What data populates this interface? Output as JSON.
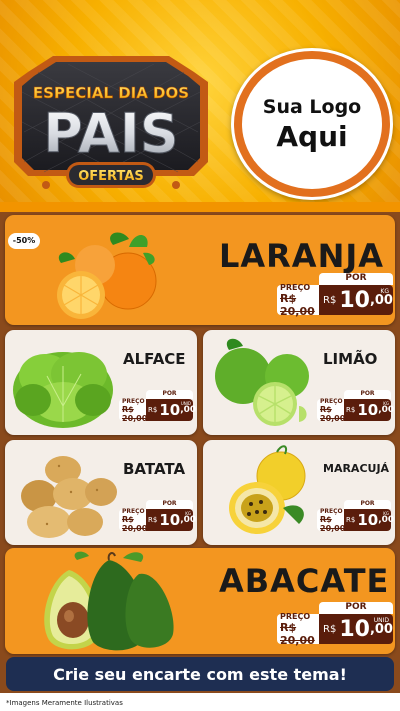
{
  "header": {
    "badge_top": "ESPECIAL DIA DOS",
    "badge_main": "PAIS",
    "badge_sub": "OFERTAS",
    "logo_line1": "Sua Logo",
    "logo_line2": "Aqui"
  },
  "colors": {
    "orange": "#f39620",
    "brown": "#5a1d0b",
    "navy": "#1e2e52",
    "yellow": "#ffd33a"
  },
  "discount_badge": "-50%",
  "products": [
    {
      "name": "LARANJA",
      "preco_label": "PREÇO",
      "old_price": "R$ 20,00",
      "por_label": "POR",
      "currency": "R$",
      "price_int": "10",
      "price_cents": ",00",
      "unit": "KG"
    },
    {
      "name": "ALFACE",
      "preco_label": "PREÇO",
      "old_price": "R$ 20,00",
      "por_label": "POR",
      "currency": "R$",
      "price_int": "10",
      "price_cents": ",00",
      "unit": "UNID"
    },
    {
      "name": "LIMÃO",
      "preco_label": "PREÇO",
      "old_price": "R$ 20,00",
      "por_label": "POR",
      "currency": "R$",
      "price_int": "10",
      "price_cents": ",00",
      "unit": "KG"
    },
    {
      "name": "BATATA",
      "preco_label": "PREÇO",
      "old_price": "R$ 20,00",
      "por_label": "POR",
      "currency": "R$",
      "price_int": "10",
      "price_cents": ",00",
      "unit": "KG"
    },
    {
      "name": "MARACUJÁ",
      "preco_label": "PREÇO",
      "old_price": "R$ 20,00",
      "por_label": "POR",
      "currency": "R$",
      "price_int": "10",
      "price_cents": ",00",
      "unit": "KG"
    },
    {
      "name": "ABACATE",
      "preco_label": "PREÇO",
      "old_price": "R$ 20,00",
      "por_label": "POR",
      "currency": "R$",
      "price_int": "10",
      "price_cents": ",00",
      "unit": "UNID"
    }
  ],
  "cta": "Crie seu encarte com este tema!",
  "footnote": "*Imagens Meramente Ilustrativas"
}
